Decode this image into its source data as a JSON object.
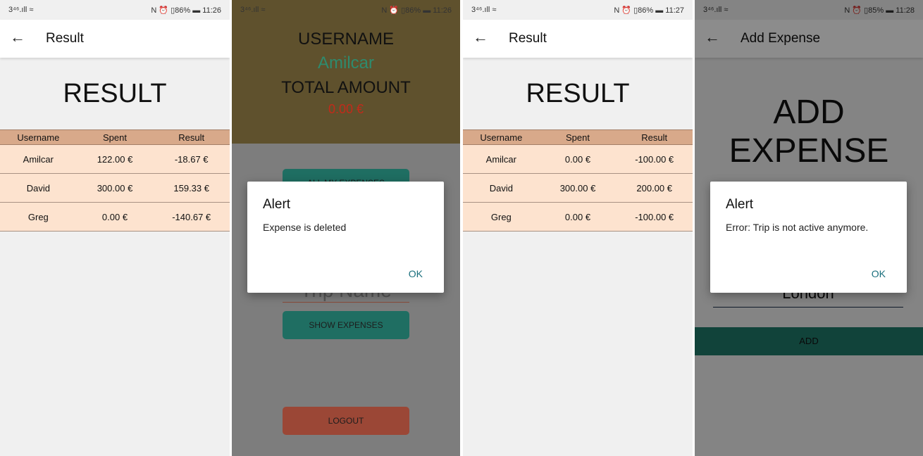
{
  "screens": [
    {
      "status": {
        "left": "3⁴⁶.ıll ≈",
        "right": "N ⏰ ▯86% ▬ 11:26"
      },
      "appbar": {
        "title": "Result"
      },
      "heading": "RESULT",
      "table": {
        "headers": [
          "Username",
          "Spent",
          "Result"
        ],
        "rows": [
          [
            "Amilcar",
            "122.00 €",
            "-18.67 €"
          ],
          [
            "David",
            "300.00 €",
            "159.33 €"
          ],
          [
            "Greg",
            "0.00 €",
            "-140.67 €"
          ]
        ]
      }
    },
    {
      "status": {
        "left": "3⁴⁶.ıll ≈",
        "right": "N ⏰ ▯86% ▬ 11:26"
      },
      "user": {
        "username_label": "USERNAME",
        "username": "Amilcar",
        "total_label": "TOTAL AMOUNT",
        "total": "0.00 €"
      },
      "buttons": {
        "all_expenses": "ALL MY EXPENSES",
        "show_expenses": "SHOW EXPENSES",
        "logout": "LOGOUT"
      },
      "trip_placeholder": "Trip Name",
      "dialog": {
        "title": "Alert",
        "message": "Expense is deleted",
        "ok": "OK"
      }
    },
    {
      "status": {
        "left": "3⁴⁶.ıll ≈",
        "right": "N ⏰ ▯86% ▬ 11:27"
      },
      "appbar": {
        "title": "Result"
      },
      "heading": "RESULT",
      "table": {
        "headers": [
          "Username",
          "Spent",
          "Result"
        ],
        "rows": [
          [
            "Amilcar",
            "0.00 €",
            "-100.00 €"
          ],
          [
            "David",
            "300.00 €",
            "200.00 €"
          ],
          [
            "Greg",
            "0.00 €",
            "-100.00 €"
          ]
        ]
      }
    },
    {
      "status": {
        "left": "3⁴⁶.ıll ≈",
        "right": "N ⏰ ▯85% ▬ 11:28"
      },
      "appbar": {
        "title": "Add Expense"
      },
      "heading": "ADD EXPENSE",
      "city_value": "London",
      "add_button": "ADD",
      "dialog": {
        "title": "Alert",
        "message": "Error: Trip is not active anymore.",
        "ok": "OK"
      }
    }
  ],
  "colors": {
    "table_header": "#d8a98a",
    "table_row": "#fde3cf",
    "username_accent": "#2e8b6e",
    "amount_red": "#c22a1a",
    "teal_button": "#1f7a6b",
    "dialog_ok": "#1a6f7d"
  }
}
